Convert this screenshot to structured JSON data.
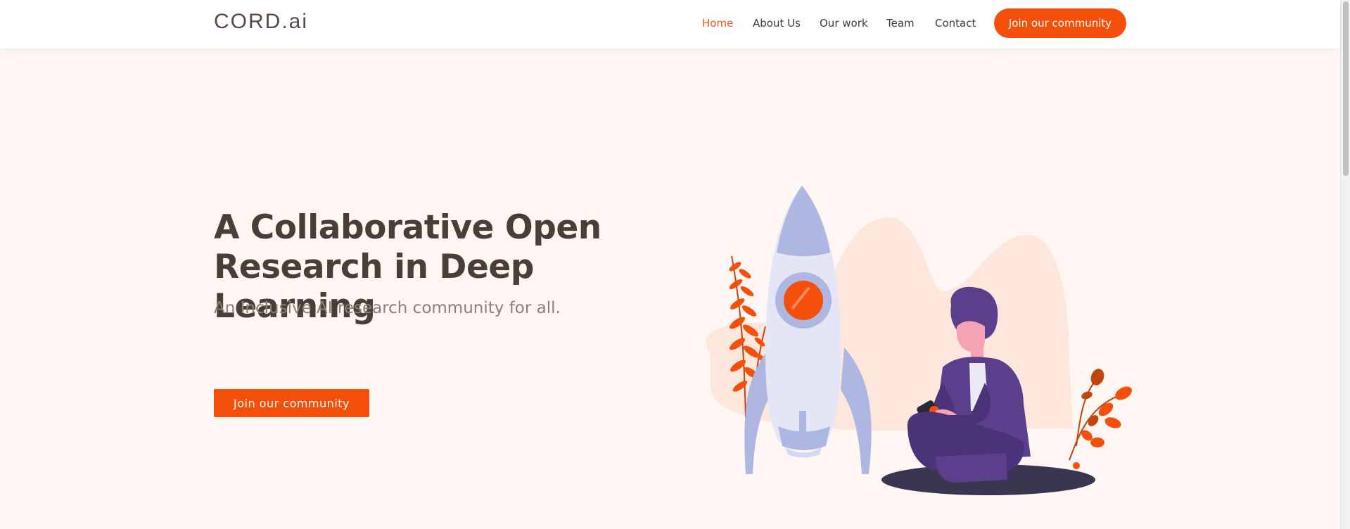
{
  "header": {
    "logo": "CORD.ai",
    "nav": [
      {
        "label": "Home",
        "active": true
      },
      {
        "label": "About Us",
        "active": false
      },
      {
        "label": "Our work",
        "active": false
      },
      {
        "label": "Team",
        "active": false
      },
      {
        "label": "Contact",
        "active": false
      }
    ],
    "cta_label": "Join our community"
  },
  "hero": {
    "title_line1": "A Collaborative Open",
    "title_line2": "Research in Deep Learning",
    "subtitle": "An Inclusive AI research community for all.",
    "cta_label": "Join our community"
  },
  "colors": {
    "accent": "#f4500c",
    "hero_background": "#fdf6f3",
    "heading": "#4b3e38",
    "rocket": "#aeb6e2",
    "person_purple": "#5b3e8c"
  },
  "icons": {
    "illustration": "rocket-and-person-illustration"
  }
}
